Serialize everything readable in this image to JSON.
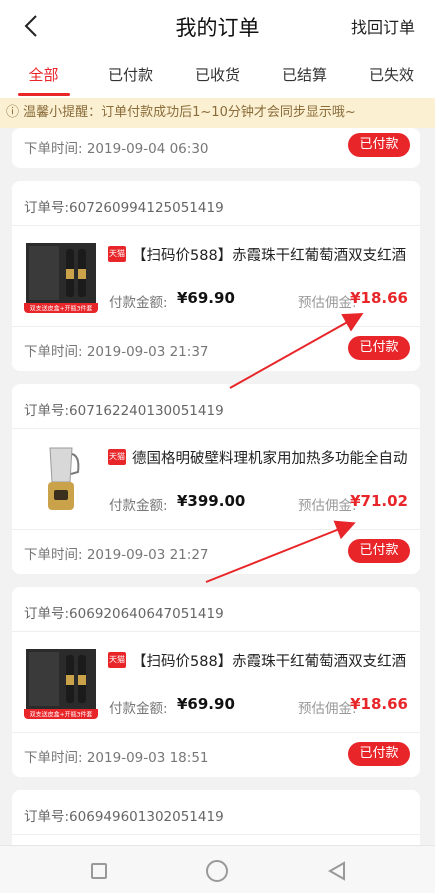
{
  "header": {
    "title": "我的订单",
    "find_order": "找回订单"
  },
  "tabs": [
    {
      "label": "全部",
      "active": true
    },
    {
      "label": "已付款"
    },
    {
      "label": "已收货"
    },
    {
      "label": "已结算"
    },
    {
      "label": "已失效"
    }
  ],
  "notice": "ⓘ 温馨小提醒：订单付款成功后1~10分钟才会同步显示哦~",
  "orders": [
    {
      "order_time": "下单时间: 2019-09-04 06:30",
      "status": "已付款"
    },
    {
      "order_no": "订单号:607260994125051419",
      "title": "【扫码价588】赤霞珠干红葡萄酒双支红酒",
      "pay_label": "付款金额:",
      "pay_amount": "¥69.90",
      "comm_label": "预估佣金:",
      "comm_amount": "¥18.66",
      "order_time": "下单时间: 2019-09-03 21:37",
      "status": "已付款",
      "img_caption": "双支送皮盒+开瓶3件套"
    },
    {
      "order_no": "订单号:607162240130051419",
      "title": "德国格明破壁料理机家用加热多功能全自动",
      "pay_label": "付款金额:",
      "pay_amount": "¥399.00",
      "comm_label": "预估佣金:",
      "comm_amount": "¥71.02",
      "order_time": "下单时间: 2019-09-03 21:27",
      "status": "已付款"
    },
    {
      "order_no": "订单号:606920640647051419",
      "title": "【扫码价588】赤霞珠干红葡萄酒双支红酒",
      "pay_label": "付款金额:",
      "pay_amount": "¥69.90",
      "comm_label": "预估佣金:",
      "comm_amount": "¥18.66",
      "order_time": "下单时间: 2019-09-03 18:51",
      "status": "已付款",
      "img_caption": "双支送皮盒+开瓶3件套"
    },
    {
      "order_no": "订单号:606949601302051419"
    }
  ],
  "tmall_badge": "天猫",
  "colors": {
    "accent": "#e8262a",
    "notice_bg": "#fbf0d2",
    "notice_text": "#8a6b3a"
  },
  "icons": [
    "back-icon",
    "nav-square-icon",
    "nav-home-icon",
    "nav-back-icon"
  ]
}
